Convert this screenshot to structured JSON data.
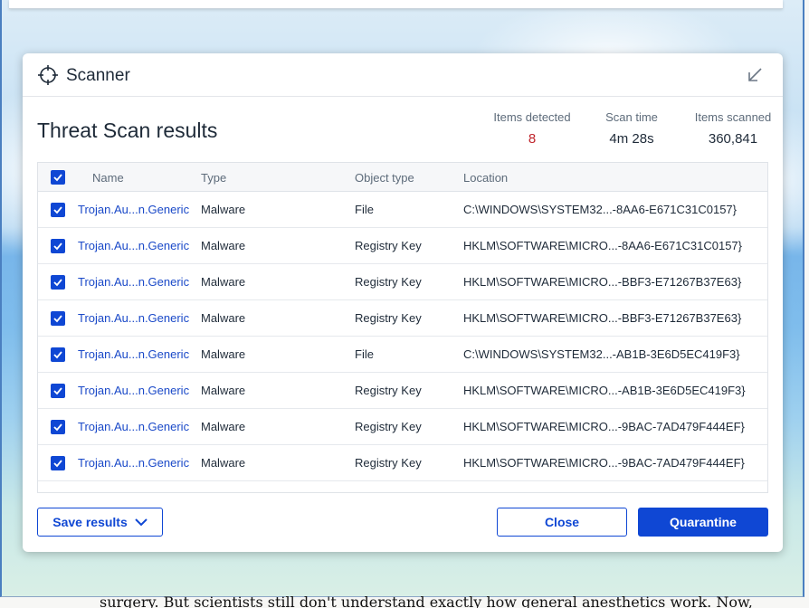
{
  "background": {
    "article_text": "surgery. But scientists still don't understand exactly how general anesthetics work. Now,"
  },
  "dialog": {
    "title": "Scanner",
    "icons": {
      "app": "crosshair-icon",
      "collapse": "collapse-arrow-icon"
    }
  },
  "results": {
    "title": "Threat Scan results",
    "stats": {
      "detected_label": "Items detected",
      "detected_value": "8",
      "time_label": "Scan time",
      "time_value": "4m 28s",
      "scanned_label": "Items scanned",
      "scanned_value": "360,841"
    }
  },
  "table": {
    "headers": {
      "name": "Name",
      "type": "Type",
      "object_type": "Object type",
      "location": "Location"
    },
    "select_all_checked": true,
    "rows": [
      {
        "name": "Trojan.Au...n.Generic",
        "type": "Malware",
        "object_type": "File",
        "location": "C:\\WINDOWS\\SYSTEM32...-8AA6-E671C31C0157}",
        "checked": true
      },
      {
        "name": "Trojan.Au...n.Generic",
        "type": "Malware",
        "object_type": "Registry Key",
        "location": "HKLM\\SOFTWARE\\MICRO...-8AA6-E671C31C0157}",
        "checked": true
      },
      {
        "name": "Trojan.Au...n.Generic",
        "type": "Malware",
        "object_type": "Registry Key",
        "location": "HKLM\\SOFTWARE\\MICRO...-BBF3-E71267B37E63}",
        "checked": true
      },
      {
        "name": "Trojan.Au...n.Generic",
        "type": "Malware",
        "object_type": "Registry Key",
        "location": "HKLM\\SOFTWARE\\MICRO...-BBF3-E71267B37E63}",
        "checked": true
      },
      {
        "name": "Trojan.Au...n.Generic",
        "type": "Malware",
        "object_type": "File",
        "location": "C:\\WINDOWS\\SYSTEM32...-AB1B-3E6D5EC419F3}",
        "checked": true
      },
      {
        "name": "Trojan.Au...n.Generic",
        "type": "Malware",
        "object_type": "Registry Key",
        "location": "HKLM\\SOFTWARE\\MICRO...-AB1B-3E6D5EC419F3}",
        "checked": true
      },
      {
        "name": "Trojan.Au...n.Generic",
        "type": "Malware",
        "object_type": "Registry Key",
        "location": "HKLM\\SOFTWARE\\MICRO...-9BAC-7AD479F444EF}",
        "checked": true
      },
      {
        "name": "Trojan.Au...n.Generic",
        "type": "Malware",
        "object_type": "Registry Key",
        "location": "HKLM\\SOFTWARE\\MICRO...-9BAC-7AD479F444EF}",
        "checked": true
      }
    ]
  },
  "buttons": {
    "save_results": "Save results",
    "close": "Close",
    "quarantine": "Quarantine"
  },
  "colors": {
    "accent": "#0f47d4",
    "link": "#1a49c8",
    "detected_value": "#c0262d"
  }
}
